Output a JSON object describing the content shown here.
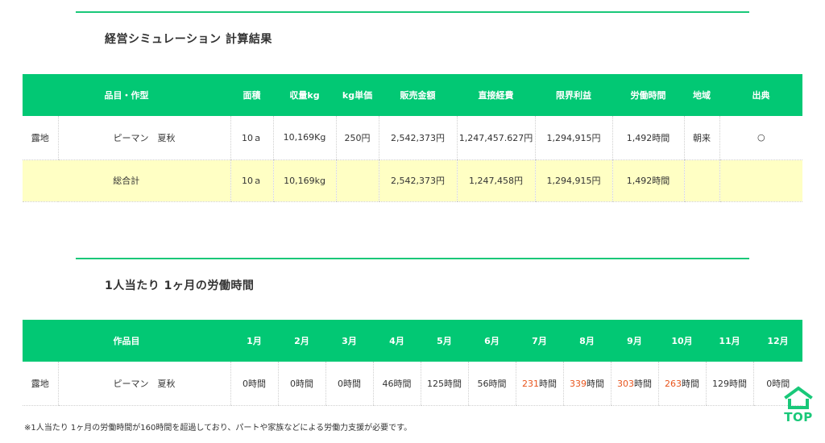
{
  "section1": {
    "title": "経営シミュレーション 計算結果",
    "headers": [
      "品目・作型",
      "面積",
      "収量kg",
      "kg単価",
      "販売金額",
      "直接経費",
      "限界利益",
      "労働時間",
      "地域",
      "出典"
    ],
    "rows": [
      {
        "type": "露地",
        "item": "ピーマン　夏秋",
        "area": "10ａ",
        "yield": "10,169Kg",
        "unit_price": "250円",
        "sales": "2,542,373円",
        "direct_cost": "1,247,457.627円",
        "marginal_profit": "1,294,915円",
        "labor": "1,492時間",
        "region": "朝来",
        "source": "○"
      }
    ],
    "total": {
      "label": "総合計",
      "area": "10ａ",
      "yield": "10,169kg",
      "unit_price": "",
      "sales": "2,542,373円",
      "direct_cost": "1,247,458円",
      "marginal_profit": "1,294,915円",
      "labor": "1,492時間",
      "region": "",
      "source": ""
    }
  },
  "section2": {
    "title": "1人当たり 1ヶ月の労働時間",
    "headers": [
      "作品目",
      "1月",
      "2月",
      "3月",
      "4月",
      "5月",
      "6月",
      "7月",
      "8月",
      "9月",
      "10月",
      "11月",
      "12月"
    ],
    "row": {
      "type": "露地",
      "item": "ピーマン　夏秋",
      "months": [
        {
          "num": "0",
          "unit": "時間",
          "over": false
        },
        {
          "num": "0",
          "unit": "時間",
          "over": false
        },
        {
          "num": "0",
          "unit": "時間",
          "over": false
        },
        {
          "num": "46",
          "unit": "時間",
          "over": false
        },
        {
          "num": "125",
          "unit": "時間",
          "over": false
        },
        {
          "num": "56",
          "unit": "時間",
          "over": false
        },
        {
          "num": "231",
          "unit": "時間",
          "over": true
        },
        {
          "num": "339",
          "unit": "時間",
          "over": true
        },
        {
          "num": "303",
          "unit": "時間",
          "over": true
        },
        {
          "num": "263",
          "unit": "時間",
          "over": true
        },
        {
          "num": "129",
          "unit": "時間",
          "over": false
        },
        {
          "num": "0",
          "unit": "時間",
          "over": false
        }
      ]
    }
  },
  "note": "※1人当たり 1ヶ月の労働時間が160時間を超過しており、パートや家族などによる労働力支援が必要です。",
  "top_button": {
    "label": "TOP",
    "icon": "house-chevron-icon"
  },
  "colors": {
    "accent": "#02c874",
    "total_row": "#ffffc4",
    "over_limit": "#e8541c"
  }
}
